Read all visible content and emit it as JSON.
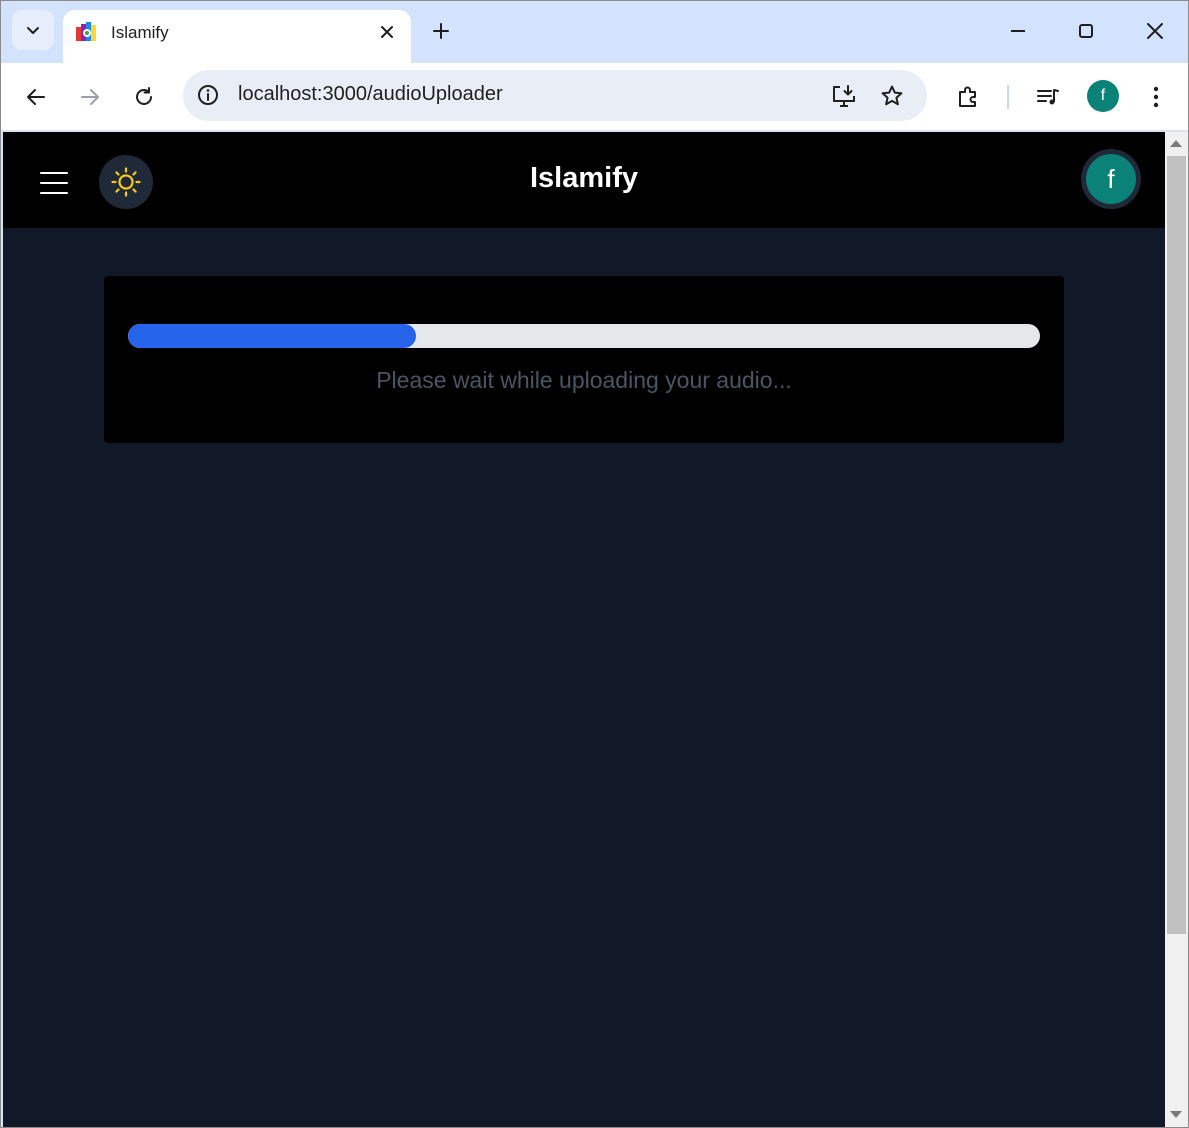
{
  "browser": {
    "tab": {
      "title": "Islamify",
      "favicon": "islamify-favicon-icon"
    },
    "address_bar": {
      "url": "localhost:3000/audioUploader"
    },
    "profile_initial": "f"
  },
  "app": {
    "title": "Islamify",
    "avatar_initial": "f",
    "theme_icon": "sun-icon"
  },
  "upload": {
    "progress_percent": 31.6,
    "status_text": "Please wait while uploading your audio..."
  },
  "colors": {
    "progress_fill": "#2563eb",
    "progress_track": "#e5e7eb",
    "page_background": "#111827",
    "header_background": "#000000",
    "avatar": "#0b8278",
    "sun": "#facc15"
  }
}
